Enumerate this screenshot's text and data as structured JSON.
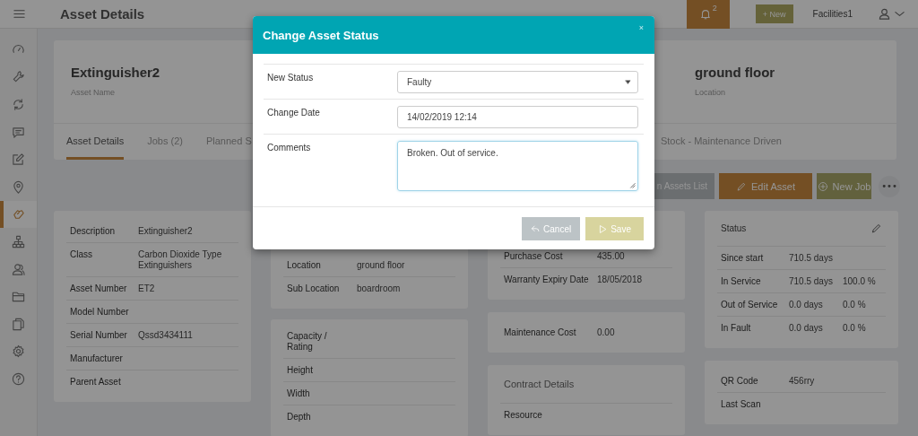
{
  "topbar": {
    "title": "Asset Details",
    "notifications": "2",
    "new_button": "+ New",
    "user": "Facilities1"
  },
  "sidebar": {
    "items": [
      {
        "selected": false
      },
      {
        "selected": false
      },
      {
        "selected": false
      },
      {
        "selected": false
      },
      {
        "selected": false
      },
      {
        "selected": false
      },
      {
        "selected": true
      },
      {
        "selected": false
      },
      {
        "selected": false
      },
      {
        "selected": false
      },
      {
        "selected": false
      },
      {
        "selected": false
      },
      {
        "selected": false
      }
    ]
  },
  "header": {
    "asset_name": "Extinguisher2",
    "asset_name_label": "Asset Name",
    "location": "ground floor",
    "location_label": "Location"
  },
  "tabs": [
    {
      "label": "Asset Details",
      "selected": true
    },
    {
      "label": "Jobs (2)",
      "selected": false
    },
    {
      "label": "Planned S",
      "selected": false
    },
    {
      "label": "Stock - Maintenance Driven",
      "selected": false
    }
  ],
  "actions": [
    {
      "kind": "assets",
      "label": "n Assets List"
    },
    {
      "kind": "edit",
      "label": "Edit Asset"
    },
    {
      "kind": "new",
      "label": "New Job"
    },
    {
      "kind": "more",
      "label": "•••"
    }
  ],
  "columns": [
    {
      "cards": [
        {
          "rows": [
            {
              "label": "Description",
              "value": "Extinguisher2"
            },
            {
              "label": "Class",
              "value": "Carbon Dioxide Type Extinguishers"
            },
            {
              "label": "Asset Number",
              "value": "ET2"
            },
            {
              "label": "Model Number"
            },
            {
              "label": "Serial Number",
              "value": "Qssd3434111"
            },
            {
              "label": "Manufacturer"
            },
            {
              "label": "Parent Asset"
            }
          ]
        }
      ]
    },
    {
      "cards": [
        {
          "rows": [
            {
              "label": "Location",
              "value": "ground floor"
            },
            {
              "label": "Sub Location",
              "value": "boardroom"
            }
          ]
        },
        {
          "rows": [
            {
              "label": "Capacity / Rating"
            },
            {
              "label": "Height"
            },
            {
              "label": "Width"
            },
            {
              "label": "Depth"
            }
          ]
        }
      ]
    },
    {
      "cards": [
        {
          "rows": [
            {
              "label": "Purchase Cost",
              "value": "435.00"
            },
            {
              "label": "Warranty Expiry Date",
              "value": "18/05/2018"
            }
          ]
        },
        {
          "rows": [
            {
              "label": "Maintenance Cost",
              "value": "0.00"
            }
          ]
        },
        {
          "title": "Contract Details",
          "rows": [
            {
              "label": "Resource"
            }
          ]
        }
      ]
    },
    {
      "cards": [
        {
          "title": "Status",
          "editable": true,
          "rows": [
            {
              "label": "Since start",
              "value": "710.5 days"
            },
            {
              "label": "In Service",
              "value": "710.5 days",
              "extra": "100.0 %"
            },
            {
              "label": "Out of Service",
              "value": "0.0 days",
              "extra": "0.0 %"
            },
            {
              "label": "In Fault",
              "value": "0.0 days",
              "extra": "0.0 %"
            }
          ]
        },
        {
          "rows": [
            {
              "label": "QR Code",
              "value": "456rry"
            },
            {
              "label": "Last Scan"
            }
          ]
        }
      ]
    }
  ],
  "modal": {
    "title": "Change Asset Status",
    "close": "×",
    "fields": [
      {
        "kind": "select",
        "label": "New Status",
        "value": "Faulty"
      },
      {
        "kind": "input",
        "label": "Change Date",
        "value": "14/02/2019 12:14"
      },
      {
        "kind": "textarea",
        "label": "Comments",
        "value": "Broken. Out of service."
      }
    ],
    "buttons": [
      {
        "kind": "cancel",
        "label": "Cancel"
      },
      {
        "kind": "save",
        "label": "Save"
      }
    ]
  }
}
